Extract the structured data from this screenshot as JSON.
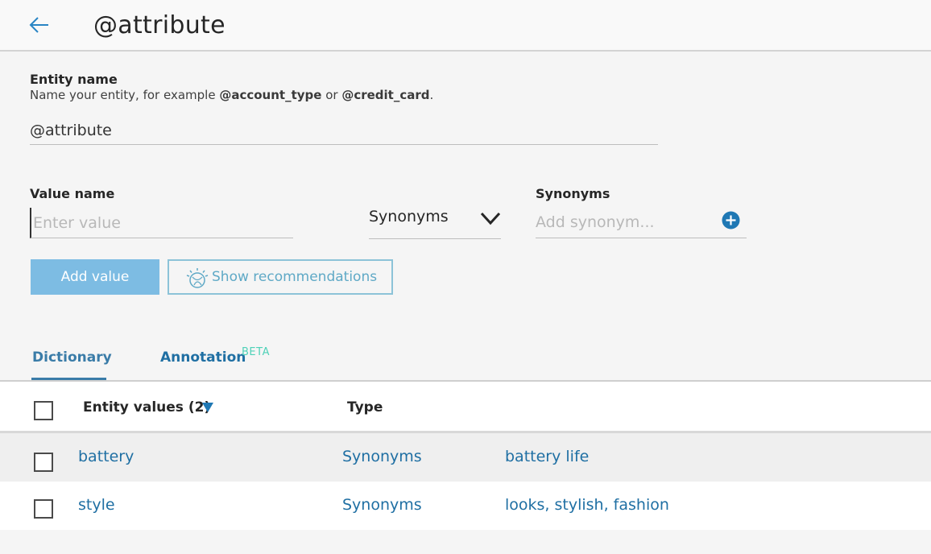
{
  "header": {
    "title": "@attribute",
    "back_icon": "arrow-left-icon"
  },
  "entity": {
    "label": "Entity name",
    "helper_prefix": "Name your entity, for example ",
    "helper_example1": "@account_type",
    "helper_or": " or ",
    "helper_example2": "@credit_card",
    "helper_suffix": ".",
    "value": "@attribute"
  },
  "value_form": {
    "value_label": "Value name",
    "value_placeholder": "Enter value",
    "type_selected": "Synonyms",
    "synonyms_label": "Synonyms",
    "synonym_placeholder": "Add synonym...",
    "add_button": "Add value",
    "recommend_button": "Show recommendations"
  },
  "tabs": {
    "dictionary": "Dictionary",
    "annotation": "Annotation",
    "annotation_badge": "BETA"
  },
  "table": {
    "col_values": "Entity values (2)",
    "col_type": "Type",
    "rows": [
      {
        "value": "battery",
        "type": "Synonyms",
        "synonyms": "battery life"
      },
      {
        "value": "style",
        "type": "Synonyms",
        "synonyms": "looks, stylish, fashion"
      }
    ]
  },
  "colors": {
    "accent": "#1f6fa3",
    "primary_button": "#7dbce3",
    "beta": "#4fd1b8"
  }
}
